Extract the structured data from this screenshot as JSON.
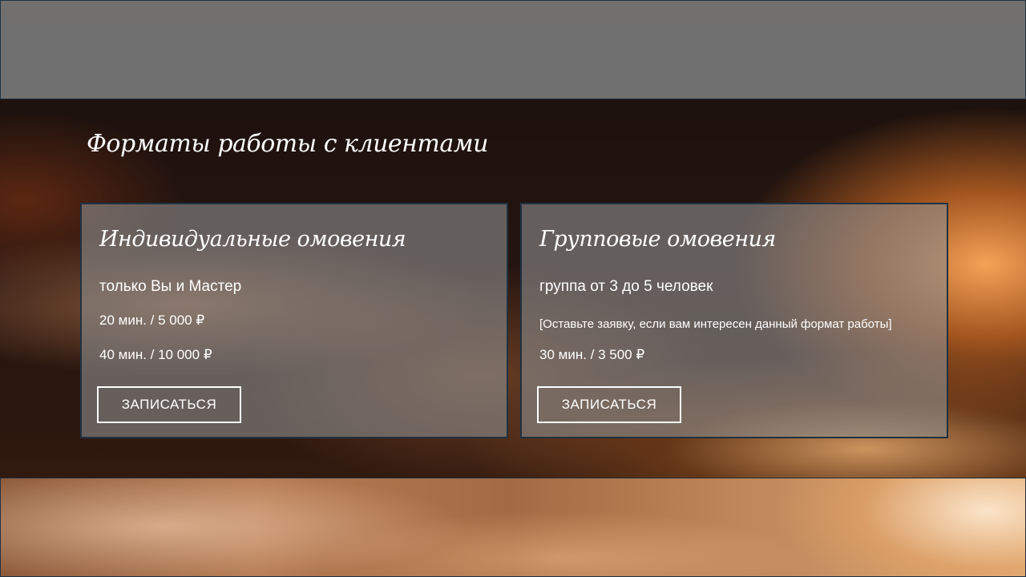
{
  "section": {
    "title": "Форматы работы с клиентами"
  },
  "cards": [
    {
      "title": "Индивидуальные омовения",
      "subtitle": "только Вы и Мастер",
      "lines": [
        "20 мин. / 5 000 ₽",
        "40 мин. / 10 000 ₽"
      ],
      "button_label": "ЗАПИСАТЬСЯ"
    },
    {
      "title": "Групповые омовения",
      "subtitle": "группа от 3 до 5 человек",
      "note": "[Оставьте заявку, если вам интересен данный формат работы]",
      "lines": [
        "30 мин. / 3 500 ₽"
      ],
      "button_label": "ЗАПИСАТЬСЯ"
    }
  ],
  "colors": {
    "card_border": "#1f3243",
    "button_border": "#ffffff",
    "text": "#ffffff"
  }
}
